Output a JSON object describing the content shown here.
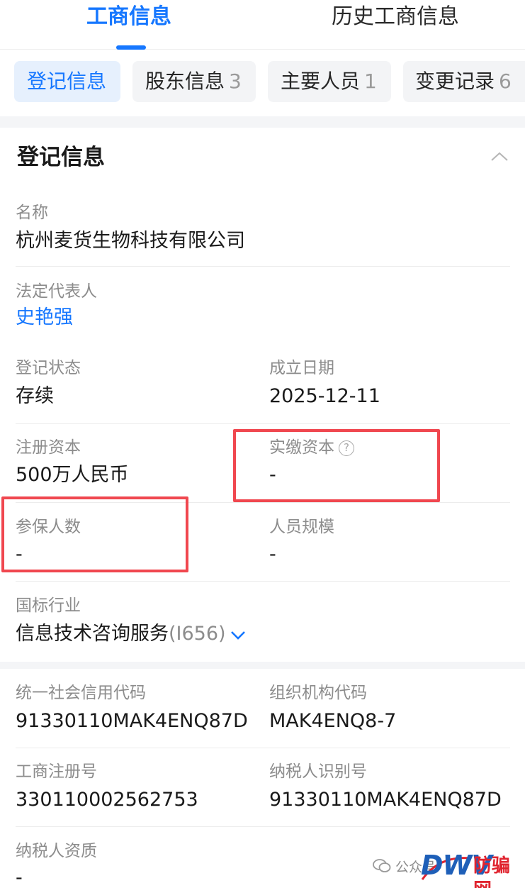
{
  "top_tabs": {
    "active": "工商信息",
    "inactive": "历史工商信息"
  },
  "sub_tabs": [
    {
      "label": "登记信息",
      "count": ""
    },
    {
      "label": "股东信息",
      "count": "3"
    },
    {
      "label": "主要人员",
      "count": "1"
    },
    {
      "label": "变更记录",
      "count": "6"
    }
  ],
  "section": {
    "title": "登记信息"
  },
  "fields": {
    "name": {
      "label": "名称",
      "value": "杭州麦货生物科技有限公司"
    },
    "legal_rep": {
      "label": "法定代表人",
      "value": "史艳强"
    },
    "reg_status": {
      "label": "登记状态",
      "value": "存续"
    },
    "found_date": {
      "label": "成立日期",
      "value": "2025-12-11"
    },
    "reg_capital": {
      "label": "注册资本",
      "value": "500万人民币"
    },
    "paid_capital": {
      "label": "实缴资本",
      "value": "-"
    },
    "insured_count": {
      "label": "参保人数",
      "value": "-"
    },
    "staff_size": {
      "label": "人员规模",
      "value": "-"
    },
    "industry": {
      "label": "国标行业",
      "value": "信息技术咨询服务",
      "code": "(I656)"
    },
    "credit_code": {
      "label": "统一社会信用代码",
      "value": "91330110MAK4ENQ87D"
    },
    "org_code": {
      "label": "组织机构代码",
      "value": "MAK4ENQ8-7"
    },
    "biz_reg_no": {
      "label": "工商注册号",
      "value": "330110002562753"
    },
    "taxpayer_id": {
      "label": "纳税人识别号",
      "value": "91330110MAK4ENQ87D"
    },
    "taxpayer_qual": {
      "label": "纳税人资质",
      "value": "-"
    }
  },
  "watermark": {
    "text": "公众号",
    "logo": "DWV",
    "cn": "防骗网"
  },
  "icons": {
    "help": "question-circle-icon",
    "collapse": "chevron-up-icon",
    "expand": "chevron-down-icon",
    "wechat": "wechat-icon"
  },
  "colors": {
    "accent": "#1677ff",
    "highlight": "#f0474f"
  }
}
